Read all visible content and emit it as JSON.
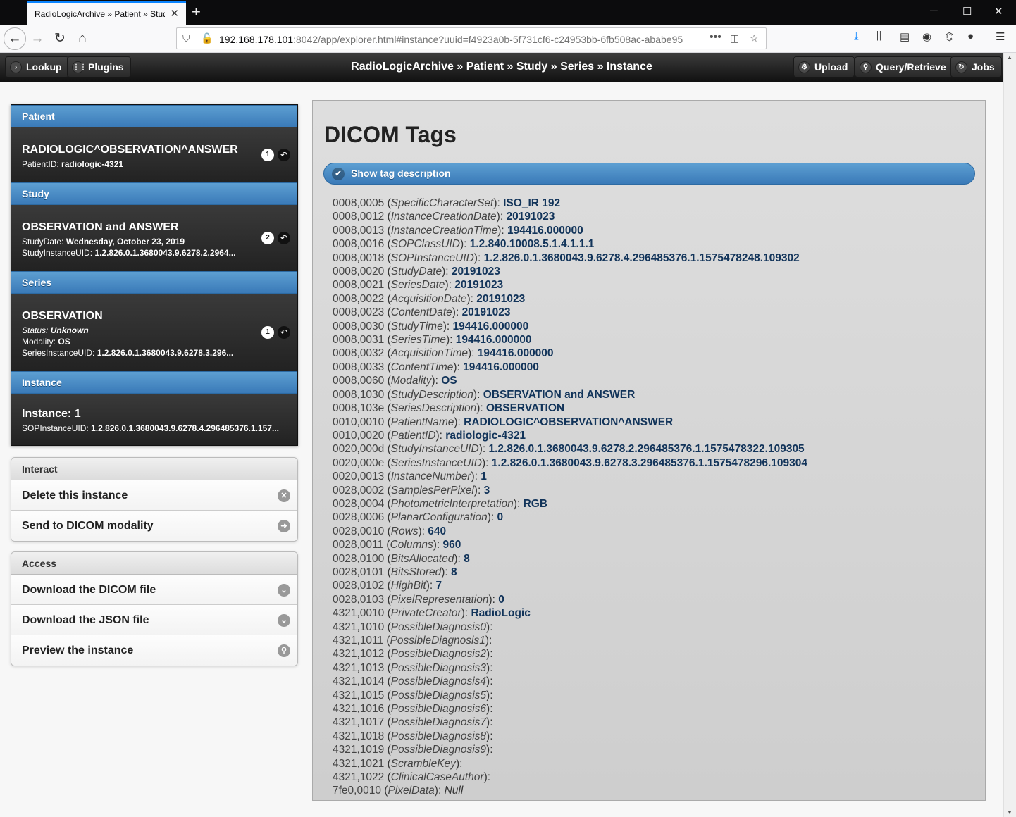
{
  "browser": {
    "tab_title": "RadioLogicArchive » Patient » Stud",
    "url_host": "192.168.178.101",
    "url_rest": ":8042/app/explorer.html#instance?uuid=f4923a0b-5f731cf6-c24953bb-6fb508ac-ababe95",
    "url_menu": "•••"
  },
  "header": {
    "lookup": "Lookup",
    "plugins": "Plugins",
    "title": "RadioLogicArchive » Patient » Study » Series » Instance",
    "upload": "Upload",
    "query": "Query/Retrieve",
    "jobs": "Jobs"
  },
  "patient": {
    "divider": "Patient",
    "name": "RADIOLOGIC^OBSERVATION^ANSWER",
    "id_label": "PatientID:",
    "id_value": "radiologic-4321",
    "count": "1"
  },
  "study": {
    "divider": "Study",
    "name": "OBSERVATION and ANSWER",
    "date_label": "StudyDate:",
    "date_value": "Wednesday, October 23, 2019",
    "uid_label": "StudyInstanceUID:",
    "uid_value": "1.2.826.0.1.3680043.9.6278.2.2964...",
    "count": "2"
  },
  "series": {
    "divider": "Series",
    "name": "OBSERVATION",
    "status_label": "Status:",
    "status_value": "Unknown",
    "modality_label": "Modality:",
    "modality_value": "OS",
    "uid_label": "SeriesInstanceUID:",
    "uid_value": "1.2.826.0.1.3680043.9.6278.3.296...",
    "count": "1"
  },
  "instance": {
    "divider": "Instance",
    "name": "Instance: 1",
    "uid_label": "SOPInstanceUID:",
    "uid_value": "1.2.826.0.1.3680043.9.6278.4.296485376.1.157..."
  },
  "interact": {
    "header": "Interact",
    "delete": "Delete this instance",
    "send": "Send to DICOM modality"
  },
  "access": {
    "header": "Access",
    "download_dicom": "Download the DICOM file",
    "download_json": "Download the JSON file",
    "preview": "Preview the instance"
  },
  "main": {
    "title": "DICOM Tags",
    "toggle_label": "Show tag description"
  },
  "tags": [
    {
      "id": "0008,0005",
      "name": "SpecificCharacterSet",
      "value": "ISO_IR 192"
    },
    {
      "id": "0008,0012",
      "name": "InstanceCreationDate",
      "value": "20191023"
    },
    {
      "id": "0008,0013",
      "name": "InstanceCreationTime",
      "value": "194416.000000"
    },
    {
      "id": "0008,0016",
      "name": "SOPClassUID",
      "value": "1.2.840.10008.5.1.4.1.1.1"
    },
    {
      "id": "0008,0018",
      "name": "SOPInstanceUID",
      "value": "1.2.826.0.1.3680043.9.6278.4.296485376.1.1575478248.109302"
    },
    {
      "id": "0008,0020",
      "name": "StudyDate",
      "value": "20191023"
    },
    {
      "id": "0008,0021",
      "name": "SeriesDate",
      "value": "20191023"
    },
    {
      "id": "0008,0022",
      "name": "AcquisitionDate",
      "value": "20191023"
    },
    {
      "id": "0008,0023",
      "name": "ContentDate",
      "value": "20191023"
    },
    {
      "id": "0008,0030",
      "name": "StudyTime",
      "value": "194416.000000"
    },
    {
      "id": "0008,0031",
      "name": "SeriesTime",
      "value": "194416.000000"
    },
    {
      "id": "0008,0032",
      "name": "AcquisitionTime",
      "value": "194416.000000"
    },
    {
      "id": "0008,0033",
      "name": "ContentTime",
      "value": "194416.000000"
    },
    {
      "id": "0008,0060",
      "name": "Modality",
      "value": "OS"
    },
    {
      "id": "0008,1030",
      "name": "StudyDescription",
      "value": "OBSERVATION and ANSWER"
    },
    {
      "id": "0008,103e",
      "name": "SeriesDescription",
      "value": "OBSERVATION"
    },
    {
      "id": "0010,0010",
      "name": "PatientName",
      "value": "RADIOLOGIC^OBSERVATION^ANSWER"
    },
    {
      "id": "0010,0020",
      "name": "PatientID",
      "value": "radiologic-4321"
    },
    {
      "id": "0020,000d",
      "name": "StudyInstanceUID",
      "value": "1.2.826.0.1.3680043.9.6278.2.296485376.1.1575478322.109305"
    },
    {
      "id": "0020,000e",
      "name": "SeriesInstanceUID",
      "value": "1.2.826.0.1.3680043.9.6278.3.296485376.1.1575478296.109304"
    },
    {
      "id": "0020,0013",
      "name": "InstanceNumber",
      "value": "1"
    },
    {
      "id": "0028,0002",
      "name": "SamplesPerPixel",
      "value": "3"
    },
    {
      "id": "0028,0004",
      "name": "PhotometricInterpretation",
      "value": "RGB"
    },
    {
      "id": "0028,0006",
      "name": "PlanarConfiguration",
      "value": "0"
    },
    {
      "id": "0028,0010",
      "name": "Rows",
      "value": "640"
    },
    {
      "id": "0028,0011",
      "name": "Columns",
      "value": "960"
    },
    {
      "id": "0028,0100",
      "name": "BitsAllocated",
      "value": "8"
    },
    {
      "id": "0028,0101",
      "name": "BitsStored",
      "value": "8"
    },
    {
      "id": "0028,0102",
      "name": "HighBit",
      "value": "7"
    },
    {
      "id": "0028,0103",
      "name": "PixelRepresentation",
      "value": "0"
    },
    {
      "id": "4321,0010",
      "name": "PrivateCreator",
      "value": "RadioLogic"
    },
    {
      "id": "4321,1010",
      "name": "PossibleDiagnosis0",
      "value": ""
    },
    {
      "id": "4321,1011",
      "name": "PossibleDiagnosis1",
      "value": ""
    },
    {
      "id": "4321,1012",
      "name": "PossibleDiagnosis2",
      "value": ""
    },
    {
      "id": "4321,1013",
      "name": "PossibleDiagnosis3",
      "value": ""
    },
    {
      "id": "4321,1014",
      "name": "PossibleDiagnosis4",
      "value": ""
    },
    {
      "id": "4321,1015",
      "name": "PossibleDiagnosis5",
      "value": ""
    },
    {
      "id": "4321,1016",
      "name": "PossibleDiagnosis6",
      "value": ""
    },
    {
      "id": "4321,1017",
      "name": "PossibleDiagnosis7",
      "value": ""
    },
    {
      "id": "4321,1018",
      "name": "PossibleDiagnosis8",
      "value": ""
    },
    {
      "id": "4321,1019",
      "name": "PossibleDiagnosis9",
      "value": ""
    },
    {
      "id": "4321,1021",
      "name": "ScrambleKey",
      "value": ""
    },
    {
      "id": "4321,1022",
      "name": "ClinicalCaseAuthor",
      "value": ""
    },
    {
      "id": "7fe0,0010",
      "name": "PixelData",
      "value": "Null",
      "is_null": true
    }
  ]
}
